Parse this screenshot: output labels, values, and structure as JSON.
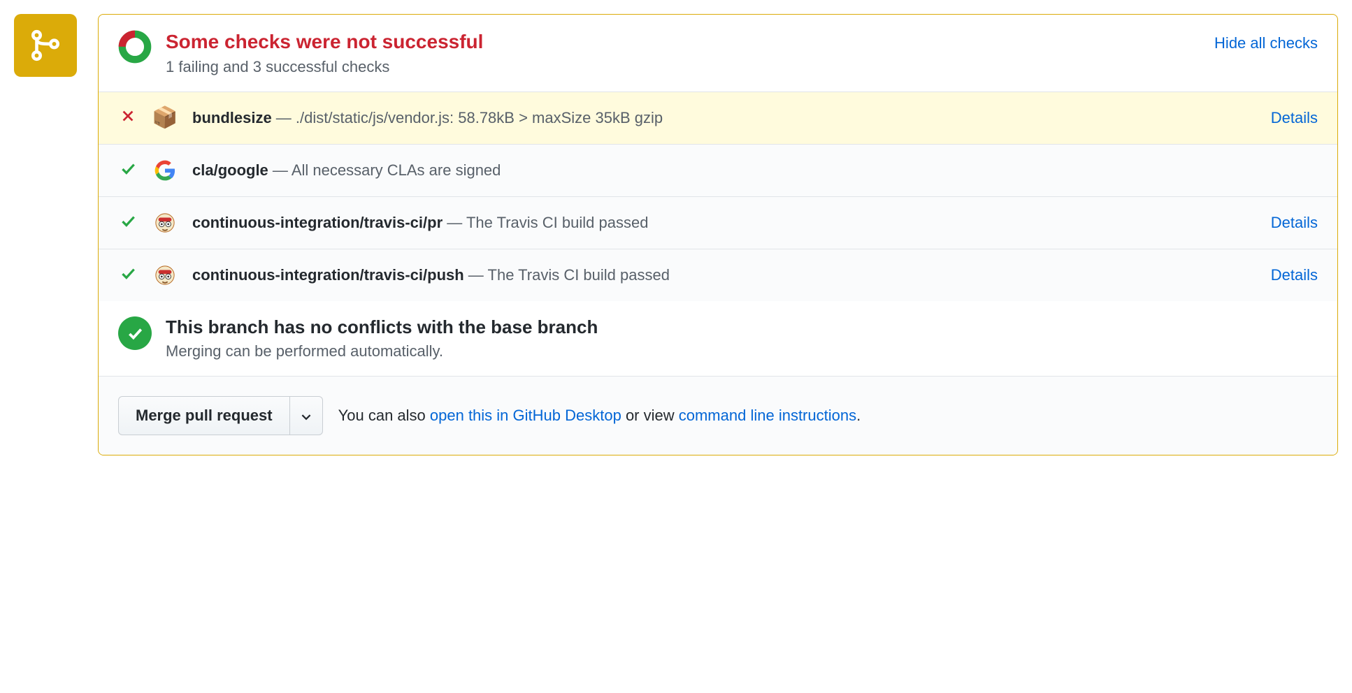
{
  "header": {
    "title": "Some checks were not successful",
    "subtitle": "1 failing and 3 successful checks",
    "hide_label": "Hide all checks"
  },
  "checks": [
    {
      "status": "fail",
      "icon": "package",
      "name": "bundlesize",
      "desc": "./dist/static/js/vendor.js: 58.78kB > maxSize 35kB gzip",
      "details": "Details"
    },
    {
      "status": "pass",
      "icon": "google",
      "name": "cla/google",
      "desc": "All necessary CLAs are signed",
      "details": ""
    },
    {
      "status": "pass",
      "icon": "travis",
      "name": "continuous-integration/travis-ci/pr",
      "desc": "The Travis CI build passed",
      "details": "Details"
    },
    {
      "status": "pass",
      "icon": "travis",
      "name": "continuous-integration/travis-ci/push",
      "desc": "The Travis CI build passed",
      "details": "Details"
    }
  ],
  "merge": {
    "title": "This branch has no conflicts with the base branch",
    "subtitle": "Merging can be performed automatically."
  },
  "actions": {
    "merge_button": "Merge pull request",
    "hint_prefix": "You can also ",
    "desktop_link": "open this in GitHub Desktop",
    "hint_mid": " or view ",
    "cli_link": "command line instructions",
    "hint_suffix": "."
  }
}
